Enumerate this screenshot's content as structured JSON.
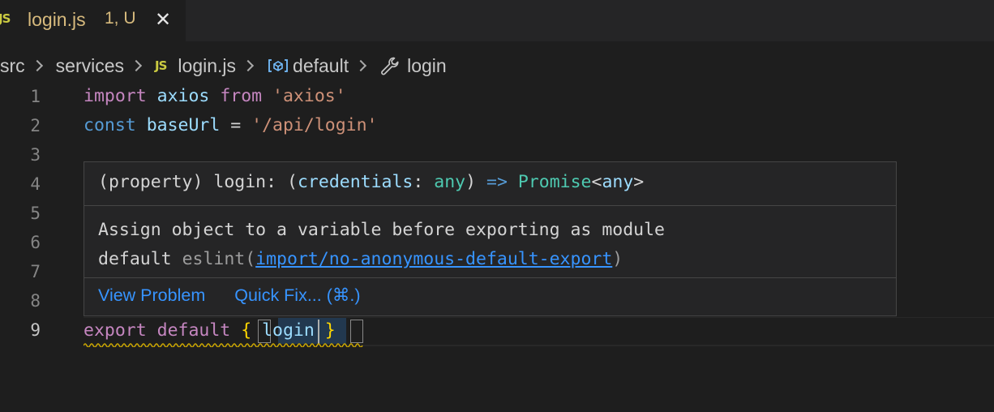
{
  "tab": {
    "icon": "JS",
    "filename": "login.js",
    "badge": "1, U",
    "close_icon": "close-icon"
  },
  "breadcrumb": {
    "items": [
      "src",
      "services",
      "login.js",
      "default",
      "login"
    ],
    "file_icon": "JS"
  },
  "gutter": {
    "line_numbers": [
      "1",
      "2",
      "3",
      "4",
      "5",
      "6",
      "7",
      "8",
      "9"
    ],
    "active_line": "9"
  },
  "code": {
    "line1": {
      "kw": "import",
      "ident": "axios",
      "from": "from",
      "str": "'axios'"
    },
    "line2": {
      "kw": "const",
      "ident": "baseUrl",
      "op": "=",
      "str": "'/api/login'"
    },
    "line9": {
      "kw1": "export",
      "kw2": "default",
      "open": "{",
      "ident": "login",
      "close": "}"
    }
  },
  "hover": {
    "signature": {
      "prefix": "(property)",
      "name": "login:",
      "open": "(",
      "param": "credentials",
      "colon": ":",
      "param_type": "any",
      "close": ")",
      "arrow": "=>",
      "return_type": "Promise",
      "generic_open": "<",
      "generic_type": "any",
      "generic_close": ">"
    },
    "message_line1": "Assign object to a variable before exporting as module",
    "message_line2_prefix": "default",
    "source": "eslint(",
    "rule_link": "import/no-anonymous-default-export",
    "source_close": ")",
    "actions": {
      "view_problem": "View Problem",
      "quick_fix": "Quick Fix... (⌘.)"
    }
  },
  "colors": {
    "editor_bg": "#1e1e1e",
    "keyword": "#c586c0",
    "storage": "#569cd6",
    "identifier": "#9cdcfe",
    "string": "#ce9178",
    "type": "#4ec9b0",
    "link": "#3794ff",
    "modified_tab": "#d7ba7d",
    "warning_squiggle": "#cca700"
  }
}
